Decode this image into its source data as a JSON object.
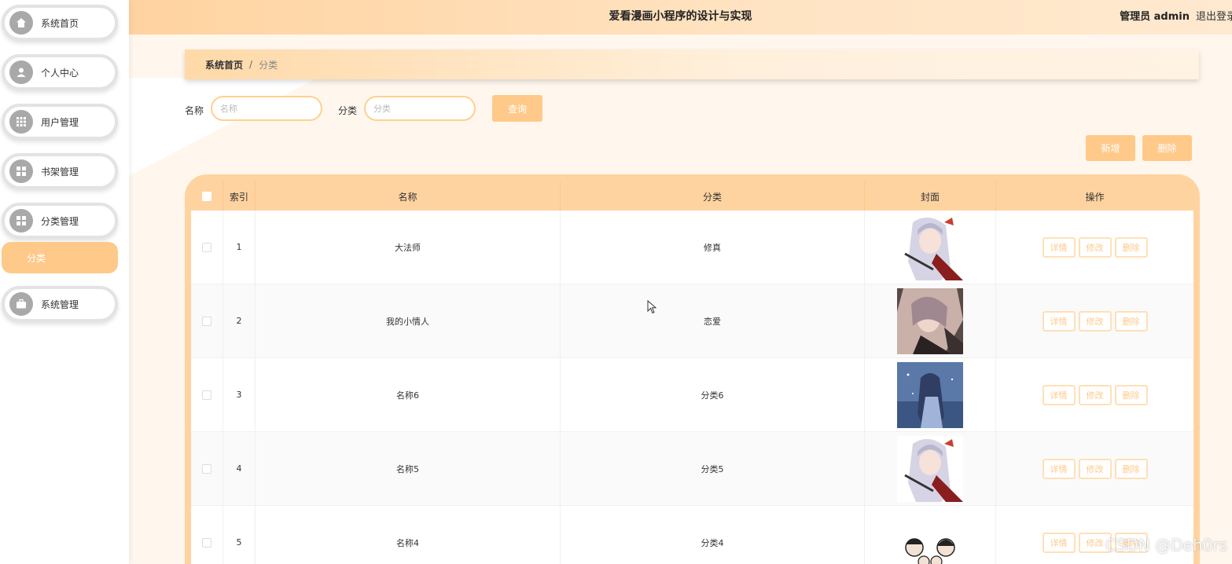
{
  "sidebar": {
    "items": [
      {
        "label": "系统首页",
        "icon": "home-icon"
      },
      {
        "label": "个人中心",
        "icon": "user-icon"
      },
      {
        "label": "用户管理",
        "icon": "grid-icon"
      },
      {
        "label": "书架管理",
        "icon": "apps-icon"
      },
      {
        "label": "分类管理",
        "icon": "apps-icon"
      },
      {
        "label": "系统管理",
        "icon": "briefcase-icon"
      }
    ],
    "sub_item": "分类"
  },
  "header": {
    "title": "爱看漫画小程序的设计与实现",
    "user": "管理员 admin",
    "logout": "退出登录"
  },
  "breadcrumb": {
    "home": "系统首页",
    "separator": "/",
    "current": "分类"
  },
  "search": {
    "name_label": "名称",
    "name_placeholder": "名称",
    "category_label": "分类",
    "category_placeholder": "分类",
    "query_button": "查询"
  },
  "toolbar": {
    "add_button": "新增",
    "delete_button": "删除"
  },
  "table": {
    "headers": {
      "index": "索引",
      "name": "名称",
      "category": "分类",
      "cover": "封面",
      "ops": "操作"
    },
    "rows": [
      {
        "index": "1",
        "name": "大法师",
        "category": "修真"
      },
      {
        "index": "2",
        "name": "我的小情人",
        "category": "恋爱"
      },
      {
        "index": "3",
        "name": "名称6",
        "category": "分类6"
      },
      {
        "index": "4",
        "name": "名称5",
        "category": "分类5"
      },
      {
        "index": "5",
        "name": "名称4",
        "category": "分类4"
      }
    ],
    "ops": {
      "detail": "详情",
      "edit": "修改",
      "delete": "删除"
    }
  },
  "watermark": "CSDN @Deh0rs",
  "colors": {
    "accent": "#ffc98a",
    "header": "#ffd3a0",
    "border": "#ffd08f"
  }
}
